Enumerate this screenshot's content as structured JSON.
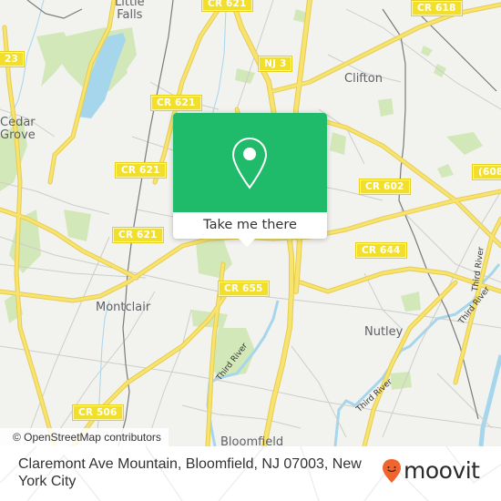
{
  "map": {
    "colors": {
      "background": "#f2f2ef",
      "park": "#cfe7b3",
      "water": "#a6d6ec",
      "road": "#f6e06b",
      "road_casing": "#e8cc4a",
      "minor_road": "#c9c9c6",
      "rail": "#777777",
      "shield_fill": "#f2df2b"
    },
    "road_shields": [
      {
        "label": "CR 621"
      },
      {
        "label": "CR 618"
      },
      {
        "label": "23"
      },
      {
        "label": "NJ 3"
      },
      {
        "label": "CR 621"
      },
      {
        "label": "CR 621"
      },
      {
        "label": "CR 621"
      },
      {
        "label": "CR 602"
      },
      {
        "label": "(608"
      },
      {
        "label": "CR 644"
      },
      {
        "label": "CR 655"
      },
      {
        "label": "CR 506"
      }
    ],
    "places": [
      {
        "name": "Little Falls",
        "line1": "Little",
        "line2": "Falls"
      },
      {
        "name": "Cedar Grove",
        "line1": "Cedar",
        "line2": "Grove"
      },
      {
        "name": "Clifton"
      },
      {
        "name": "Montclair"
      },
      {
        "name": "Nutley"
      },
      {
        "name": "Bloomfield"
      }
    ],
    "water_labels": [
      {
        "name": "Third River"
      },
      {
        "name": "Third River"
      },
      {
        "name": "Third River"
      },
      {
        "name": "Third River"
      }
    ],
    "attribution": "© OpenStreetMap contributors"
  },
  "popup": {
    "icon": "map-pin-icon",
    "button_label": "Take me there",
    "color": "#20bb6a"
  },
  "footer": {
    "address": "Claremont Ave Mountain, Bloomfield, NJ 07003, New York City",
    "brand": {
      "name": "moovit",
      "icon": "moovit-smiley-pin-icon",
      "color": "#f0642d"
    }
  }
}
